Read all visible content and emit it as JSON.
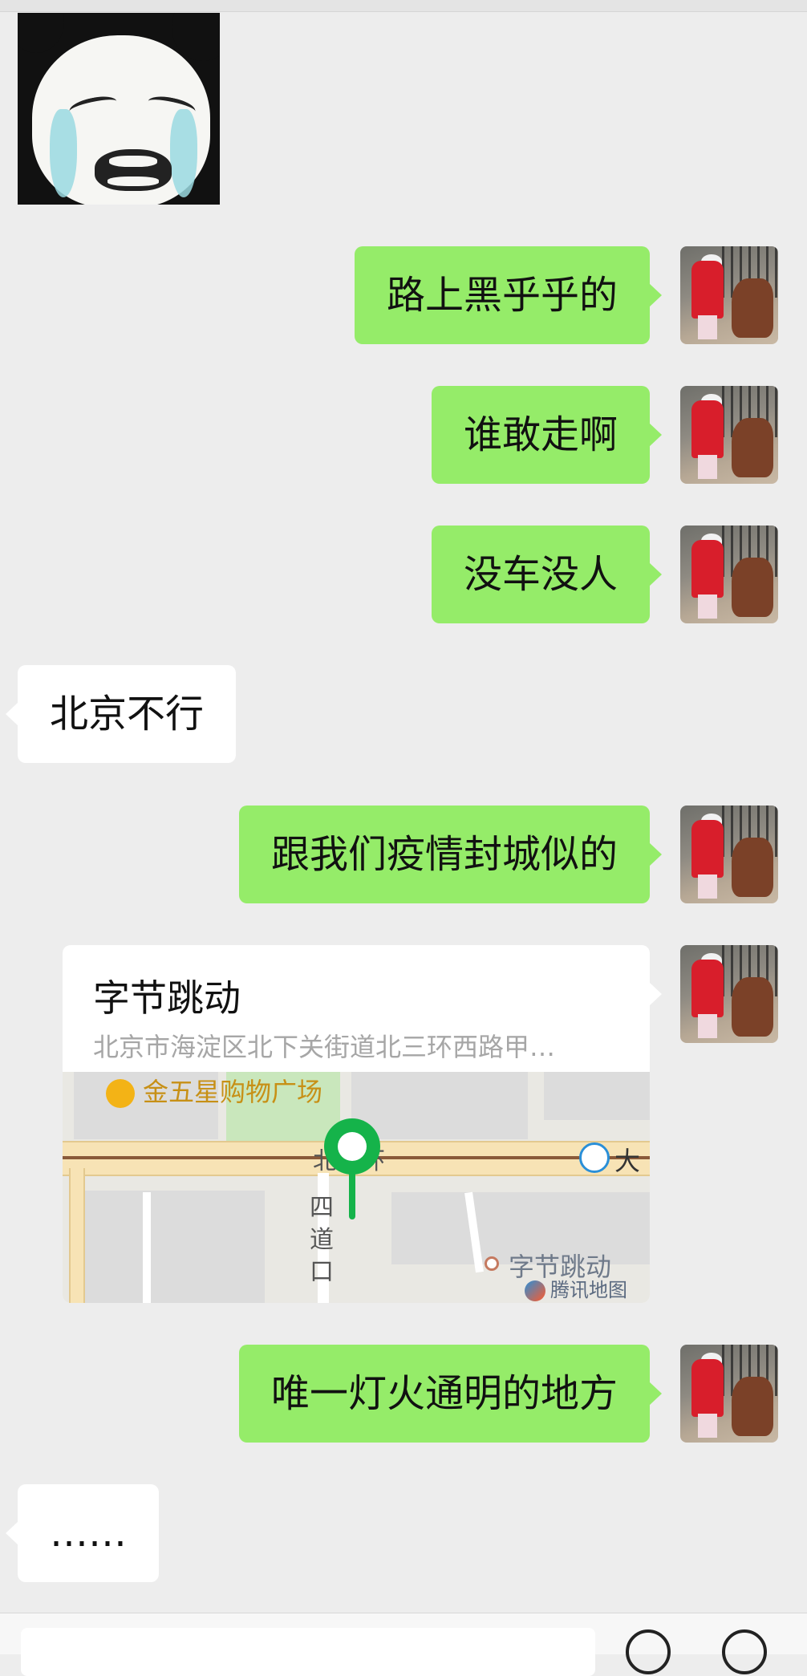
{
  "chat": {
    "messages": [
      {
        "type": "sticker",
        "side": "left",
        "icon": "crying-panda-sticker"
      },
      {
        "type": "text",
        "side": "right",
        "text": "路上黑乎乎的"
      },
      {
        "type": "text",
        "side": "right",
        "text": "谁敢走啊"
      },
      {
        "type": "text",
        "side": "right",
        "text": "没车没人"
      },
      {
        "type": "text",
        "side": "left",
        "text": "北京不行"
      },
      {
        "type": "text",
        "side": "right",
        "text": "跟我们疫情封城似的"
      },
      {
        "type": "location",
        "side": "right",
        "title": "字节跳动",
        "address": "北京市海淀区北下关街道北三环西路甲…",
        "map": {
          "poi_top": "金五星购物广场",
          "road_main": "北三环",
          "road_vertical": "四道口",
          "poi_bottom": "字节跳动",
          "metro_label": "大",
          "brand": "腾讯地图"
        }
      },
      {
        "type": "text",
        "side": "right",
        "text": "唯一灯火通明的地方"
      },
      {
        "type": "text",
        "side": "left",
        "text": "……"
      }
    ]
  },
  "colors": {
    "sent_bubble": "#95ec69",
    "received_bubble": "#ffffff",
    "background": "#ededed",
    "map_pin": "#15b34a"
  }
}
